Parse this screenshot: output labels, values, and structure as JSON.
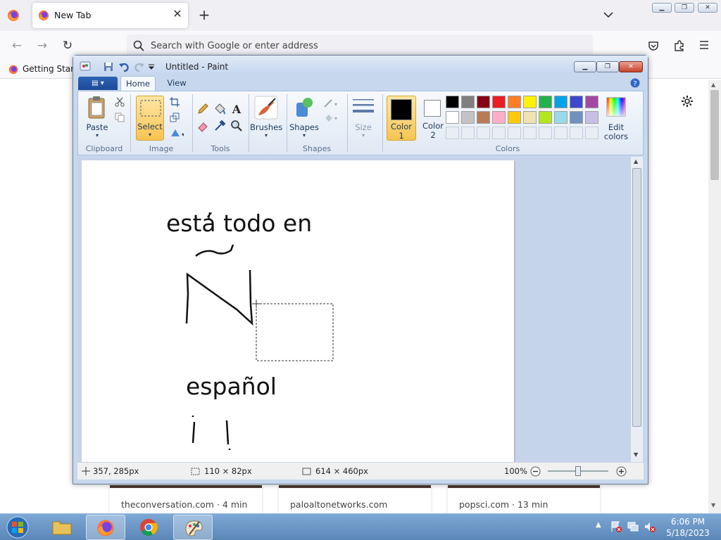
{
  "browser": {
    "tab_title": "New Tab",
    "new_tab_label": "+",
    "url_placeholder": "Search with Google or enter address",
    "bookmark_label": "Getting Started",
    "window_controls": {
      "minimize": "▁",
      "maximize": "❐",
      "close": "✕"
    },
    "top_sites": [
      {
        "caption": "theconversation.com · 4 min"
      },
      {
        "caption": "paloaltonetworks.com"
      },
      {
        "caption": "popsci.com · 13 min"
      }
    ]
  },
  "paint": {
    "title": "Untitled - Paint",
    "window_controls": {
      "minimize": "▁",
      "maximize": "❐",
      "close": "✕"
    },
    "file_tab_label": "▤ ▾",
    "tabs": {
      "home": "Home",
      "view": "View"
    },
    "ribbon": {
      "paste": "Paste",
      "select": "Select",
      "brushes": "Brushes",
      "shapes": "Shapes",
      "size": "Size",
      "color1_line1": "Color",
      "color1_line2": "1",
      "color2_line1": "Color",
      "color2_line2": "2",
      "edit_colors_line1": "Edit",
      "edit_colors_line2": "colors",
      "groups": {
        "clipboard": "Clipboard",
        "image": "Image",
        "tools": "Tools",
        "shapes": "Shapes",
        "colors": "Colors"
      },
      "palette_row1": [
        "#000000",
        "#7f7f7f",
        "#880015",
        "#ed1c24",
        "#ff7f27",
        "#fff200",
        "#22b14c",
        "#00a2e8",
        "#3f48cc",
        "#a349a4"
      ],
      "palette_row2": [
        "#ffffff",
        "#c3c3c3",
        "#b97a57",
        "#ffaec9",
        "#ffc90e",
        "#efe4b0",
        "#b5e61d",
        "#99d9ea",
        "#7092be",
        "#c8bfe7"
      ],
      "color1": "#000000",
      "color2": "#ffffff"
    },
    "canvas_text": {
      "line1": "está todo en",
      "line2": "español"
    },
    "status": {
      "cursor": "357, 285px",
      "selection": "110 × 82px",
      "image_size": "614 × 460px",
      "zoom": "100%"
    }
  },
  "taskbar": {
    "time": "6:06 PM",
    "date": "5/18/2023"
  }
}
